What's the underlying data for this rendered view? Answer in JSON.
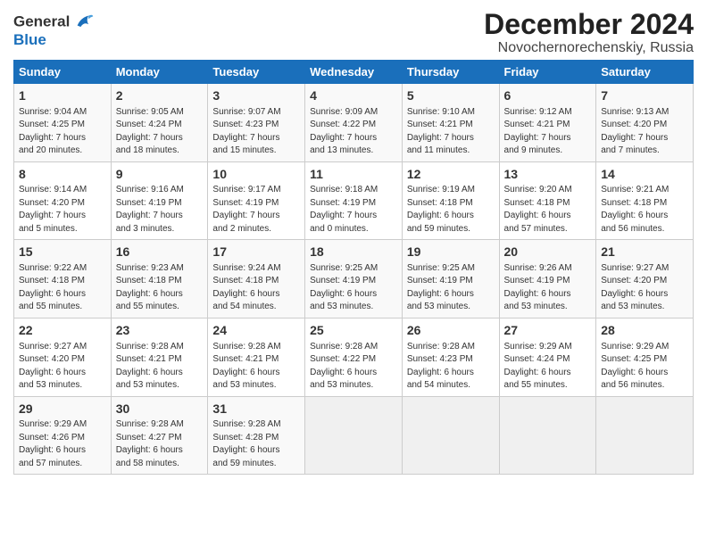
{
  "header": {
    "logo_line1": "General",
    "logo_line2": "Blue",
    "title": "December 2024",
    "subtitle": "Novochernorechenskiy, Russia"
  },
  "weekdays": [
    "Sunday",
    "Monday",
    "Tuesday",
    "Wednesday",
    "Thursday",
    "Friday",
    "Saturday"
  ],
  "weeks": [
    [
      {
        "day": "1",
        "info": "Sunrise: 9:04 AM\nSunset: 4:25 PM\nDaylight: 7 hours\nand 20 minutes."
      },
      {
        "day": "2",
        "info": "Sunrise: 9:05 AM\nSunset: 4:24 PM\nDaylight: 7 hours\nand 18 minutes."
      },
      {
        "day": "3",
        "info": "Sunrise: 9:07 AM\nSunset: 4:23 PM\nDaylight: 7 hours\nand 15 minutes."
      },
      {
        "day": "4",
        "info": "Sunrise: 9:09 AM\nSunset: 4:22 PM\nDaylight: 7 hours\nand 13 minutes."
      },
      {
        "day": "5",
        "info": "Sunrise: 9:10 AM\nSunset: 4:21 PM\nDaylight: 7 hours\nand 11 minutes."
      },
      {
        "day": "6",
        "info": "Sunrise: 9:12 AM\nSunset: 4:21 PM\nDaylight: 7 hours\nand 9 minutes."
      },
      {
        "day": "7",
        "info": "Sunrise: 9:13 AM\nSunset: 4:20 PM\nDaylight: 7 hours\nand 7 minutes."
      }
    ],
    [
      {
        "day": "8",
        "info": "Sunrise: 9:14 AM\nSunset: 4:20 PM\nDaylight: 7 hours\nand 5 minutes."
      },
      {
        "day": "9",
        "info": "Sunrise: 9:16 AM\nSunset: 4:19 PM\nDaylight: 7 hours\nand 3 minutes."
      },
      {
        "day": "10",
        "info": "Sunrise: 9:17 AM\nSunset: 4:19 PM\nDaylight: 7 hours\nand 2 minutes."
      },
      {
        "day": "11",
        "info": "Sunrise: 9:18 AM\nSunset: 4:19 PM\nDaylight: 7 hours\nand 0 minutes."
      },
      {
        "day": "12",
        "info": "Sunrise: 9:19 AM\nSunset: 4:18 PM\nDaylight: 6 hours\nand 59 minutes."
      },
      {
        "day": "13",
        "info": "Sunrise: 9:20 AM\nSunset: 4:18 PM\nDaylight: 6 hours\nand 57 minutes."
      },
      {
        "day": "14",
        "info": "Sunrise: 9:21 AM\nSunset: 4:18 PM\nDaylight: 6 hours\nand 56 minutes."
      }
    ],
    [
      {
        "day": "15",
        "info": "Sunrise: 9:22 AM\nSunset: 4:18 PM\nDaylight: 6 hours\nand 55 minutes."
      },
      {
        "day": "16",
        "info": "Sunrise: 9:23 AM\nSunset: 4:18 PM\nDaylight: 6 hours\nand 55 minutes."
      },
      {
        "day": "17",
        "info": "Sunrise: 9:24 AM\nSunset: 4:18 PM\nDaylight: 6 hours\nand 54 minutes."
      },
      {
        "day": "18",
        "info": "Sunrise: 9:25 AM\nSunset: 4:19 PM\nDaylight: 6 hours\nand 53 minutes."
      },
      {
        "day": "19",
        "info": "Sunrise: 9:25 AM\nSunset: 4:19 PM\nDaylight: 6 hours\nand 53 minutes."
      },
      {
        "day": "20",
        "info": "Sunrise: 9:26 AM\nSunset: 4:19 PM\nDaylight: 6 hours\nand 53 minutes."
      },
      {
        "day": "21",
        "info": "Sunrise: 9:27 AM\nSunset: 4:20 PM\nDaylight: 6 hours\nand 53 minutes."
      }
    ],
    [
      {
        "day": "22",
        "info": "Sunrise: 9:27 AM\nSunset: 4:20 PM\nDaylight: 6 hours\nand 53 minutes."
      },
      {
        "day": "23",
        "info": "Sunrise: 9:28 AM\nSunset: 4:21 PM\nDaylight: 6 hours\nand 53 minutes."
      },
      {
        "day": "24",
        "info": "Sunrise: 9:28 AM\nSunset: 4:21 PM\nDaylight: 6 hours\nand 53 minutes."
      },
      {
        "day": "25",
        "info": "Sunrise: 9:28 AM\nSunset: 4:22 PM\nDaylight: 6 hours\nand 53 minutes."
      },
      {
        "day": "26",
        "info": "Sunrise: 9:28 AM\nSunset: 4:23 PM\nDaylight: 6 hours\nand 54 minutes."
      },
      {
        "day": "27",
        "info": "Sunrise: 9:29 AM\nSunset: 4:24 PM\nDaylight: 6 hours\nand 55 minutes."
      },
      {
        "day": "28",
        "info": "Sunrise: 9:29 AM\nSunset: 4:25 PM\nDaylight: 6 hours\nand 56 minutes."
      }
    ],
    [
      {
        "day": "29",
        "info": "Sunrise: 9:29 AM\nSunset: 4:26 PM\nDaylight: 6 hours\nand 57 minutes."
      },
      {
        "day": "30",
        "info": "Sunrise: 9:28 AM\nSunset: 4:27 PM\nDaylight: 6 hours\nand 58 minutes."
      },
      {
        "day": "31",
        "info": "Sunrise: 9:28 AM\nSunset: 4:28 PM\nDaylight: 6 hours\nand 59 minutes."
      },
      null,
      null,
      null,
      null
    ]
  ]
}
